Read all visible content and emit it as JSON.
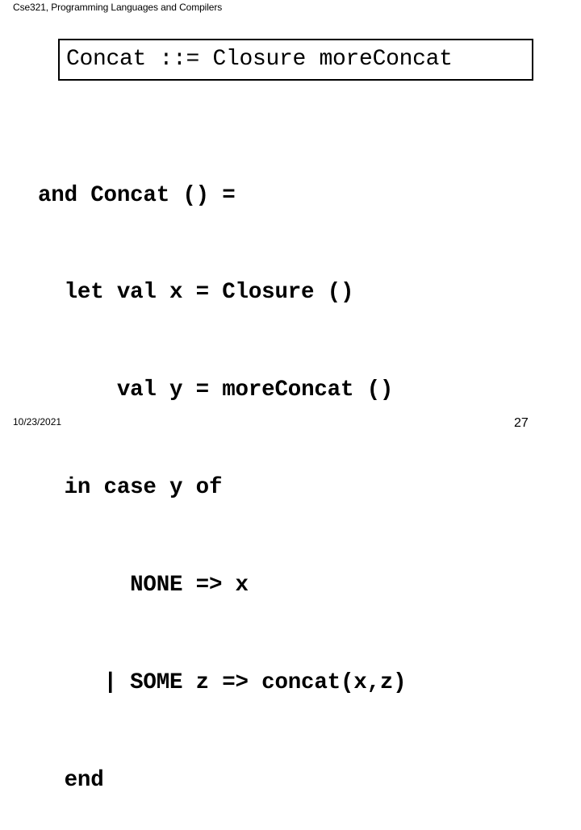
{
  "header": {
    "course_title": "Cse321, Programming Languages and Compilers"
  },
  "slide": {
    "title": "Concat ::= Closure moreConcat",
    "code_lines": [
      {
        "indent": "",
        "text": "and Concat () ="
      },
      {
        "indent": "  ",
        "text": "let val x = Closure ()"
      },
      {
        "indent": "      ",
        "text": "val y = moreConcat ()"
      },
      {
        "indent": "  ",
        "text": "in case y of"
      },
      {
        "indent": "       ",
        "text": "NONE => x"
      },
      {
        "indent": "     ",
        "text": "| SOME z => concat(x,z)"
      },
      {
        "indent": "  ",
        "text": "end"
      }
    ]
  },
  "footer": {
    "date": "10/23/2021",
    "page_number": "27"
  }
}
